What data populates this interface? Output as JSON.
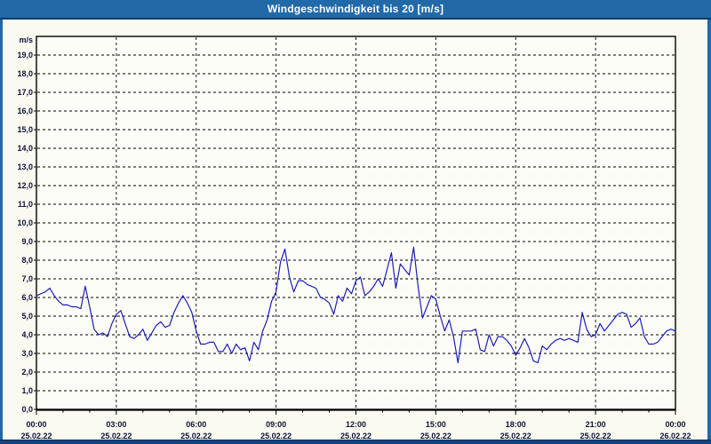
{
  "window": {
    "title": "Windgeschwindigkeit bis 20 [m/s]"
  },
  "colors": {
    "titlebar_bg": "#2169a7",
    "titlebar_edge": "#0c3a66",
    "frame_side": "#2169a7",
    "frame_bottom": "#16437f",
    "body_bg": "#fafaf0",
    "plot_bg": "#fdfdf8",
    "grid": "#000000",
    "axis_text": "#10103a",
    "line": "#1d1db5"
  },
  "chart_data": {
    "type": "line",
    "title": "Windgeschwindigkeit bis 20 [m/s]",
    "ylabel_unit": "m/s",
    "ylim": [
      0,
      20
    ],
    "ytick_step": 1.0,
    "ytick_labels": [
      "0,0",
      "1,0",
      "2,0",
      "3,0",
      "4,0",
      "5,0",
      "6,0",
      "7,0",
      "8,0",
      "9,0",
      "10,0",
      "11,0",
      "12,0",
      "13,0",
      "14,0",
      "15,0",
      "16,0",
      "17,0",
      "18,0",
      "19,0"
    ],
    "x_range_minutes": [
      0,
      1440
    ],
    "x_major_ticks": [
      {
        "time": "00:00",
        "date": "25.02.22"
      },
      {
        "time": "03:00",
        "date": "25.02.22"
      },
      {
        "time": "06:00",
        "date": "25.02.22"
      },
      {
        "time": "09:00",
        "date": "25.02.22"
      },
      {
        "time": "12:00",
        "date": "25.02.22"
      },
      {
        "time": "15:00",
        "date": "25.02.22"
      },
      {
        "time": "18:00",
        "date": "25.02.22"
      },
      {
        "time": "21:00",
        "date": "25.02.22"
      },
      {
        "time": "00:00",
        "date": "26.02.22"
      }
    ],
    "x_minor_tick_every_minutes": 60,
    "grid": "dashed",
    "legend": "none",
    "series": [
      {
        "name": "Windgeschwindigkeit [m/s]",
        "color": "#1d1db5",
        "points_format": "[minutes_from_00:00, m/s]",
        "points": [
          [
            0,
            6.1
          ],
          [
            10,
            6.2
          ],
          [
            20,
            6.3
          ],
          [
            30,
            6.5
          ],
          [
            40,
            6.1
          ],
          [
            50,
            5.8
          ],
          [
            60,
            5.6
          ],
          [
            70,
            5.6
          ],
          [
            80,
            5.5
          ],
          [
            90,
            5.5
          ],
          [
            100,
            5.4
          ],
          [
            110,
            6.6
          ],
          [
            120,
            5.5
          ],
          [
            130,
            4.3
          ],
          [
            140,
            4.0
          ],
          [
            150,
            4.1
          ],
          [
            160,
            3.9
          ],
          [
            170,
            4.6
          ],
          [
            180,
            5.1
          ],
          [
            190,
            5.3
          ],
          [
            200,
            4.6
          ],
          [
            210,
            3.9
          ],
          [
            220,
            3.8
          ],
          [
            230,
            4.0
          ],
          [
            240,
            4.3
          ],
          [
            250,
            3.7
          ],
          [
            260,
            4.1
          ],
          [
            270,
            4.5
          ],
          [
            280,
            4.7
          ],
          [
            290,
            4.4
          ],
          [
            300,
            4.5
          ],
          [
            310,
            5.2
          ],
          [
            320,
            5.7
          ],
          [
            330,
            6.1
          ],
          [
            340,
            5.7
          ],
          [
            350,
            5.2
          ],
          [
            360,
            4.2
          ],
          [
            370,
            3.5
          ],
          [
            380,
            3.5
          ],
          [
            390,
            3.6
          ],
          [
            400,
            3.6
          ],
          [
            410,
            3.1
          ],
          [
            420,
            3.1
          ],
          [
            430,
            3.5
          ],
          [
            440,
            3.0
          ],
          [
            450,
            3.5
          ],
          [
            460,
            3.2
          ],
          [
            470,
            3.3
          ],
          [
            480,
            2.6
          ],
          [
            490,
            3.6
          ],
          [
            500,
            3.2
          ],
          [
            510,
            4.2
          ],
          [
            520,
            4.8
          ],
          [
            530,
            5.8
          ],
          [
            540,
            6.3
          ],
          [
            550,
            7.9
          ],
          [
            560,
            8.6
          ],
          [
            570,
            7.1
          ],
          [
            580,
            6.3
          ],
          [
            590,
            6.9
          ],
          [
            600,
            6.9
          ],
          [
            610,
            6.7
          ],
          [
            620,
            6.6
          ],
          [
            630,
            6.5
          ],
          [
            640,
            6.0
          ],
          [
            650,
            5.9
          ],
          [
            660,
            5.7
          ],
          [
            670,
            5.1
          ],
          [
            680,
            6.1
          ],
          [
            690,
            5.8
          ],
          [
            700,
            6.5
          ],
          [
            710,
            6.2
          ],
          [
            720,
            6.9
          ],
          [
            730,
            7.1
          ],
          [
            740,
            6.1
          ],
          [
            750,
            6.3
          ],
          [
            760,
            6.6
          ],
          [
            770,
            7.0
          ],
          [
            780,
            6.6
          ],
          [
            790,
            7.5
          ],
          [
            800,
            8.4
          ],
          [
            810,
            6.5
          ],
          [
            820,
            7.8
          ],
          [
            830,
            7.5
          ],
          [
            840,
            7.2
          ],
          [
            850,
            8.7
          ],
          [
            860,
            6.6
          ],
          [
            870,
            4.9
          ],
          [
            880,
            5.5
          ],
          [
            890,
            6.1
          ],
          [
            900,
            5.9
          ],
          [
            910,
            5.0
          ],
          [
            920,
            4.2
          ],
          [
            930,
            4.8
          ],
          [
            940,
            3.9
          ],
          [
            950,
            2.5
          ],
          [
            960,
            4.2
          ],
          [
            970,
            4.2
          ],
          [
            980,
            4.2
          ],
          [
            990,
            4.3
          ],
          [
            1000,
            3.2
          ],
          [
            1010,
            3.1
          ],
          [
            1020,
            4.0
          ],
          [
            1030,
            3.4
          ],
          [
            1040,
            3.9
          ],
          [
            1050,
            3.9
          ],
          [
            1060,
            3.7
          ],
          [
            1070,
            3.4
          ],
          [
            1080,
            2.9
          ],
          [
            1090,
            3.3
          ],
          [
            1100,
            3.8
          ],
          [
            1110,
            3.3
          ],
          [
            1120,
            2.6
          ],
          [
            1130,
            2.5
          ],
          [
            1140,
            3.4
          ],
          [
            1150,
            3.2
          ],
          [
            1160,
            3.5
          ],
          [
            1170,
            3.7
          ],
          [
            1180,
            3.8
          ],
          [
            1190,
            3.7
          ],
          [
            1200,
            3.8
          ],
          [
            1210,
            3.7
          ],
          [
            1220,
            3.6
          ],
          [
            1230,
            5.2
          ],
          [
            1240,
            4.3
          ],
          [
            1250,
            3.9
          ],
          [
            1260,
            4.0
          ],
          [
            1270,
            4.6
          ],
          [
            1280,
            4.2
          ],
          [
            1290,
            4.5
          ],
          [
            1300,
            4.8
          ],
          [
            1310,
            5.1
          ],
          [
            1320,
            5.2
          ],
          [
            1330,
            5.1
          ],
          [
            1340,
            4.4
          ],
          [
            1350,
            4.6
          ],
          [
            1360,
            4.9
          ],
          [
            1370,
            3.9
          ],
          [
            1380,
            3.5
          ],
          [
            1390,
            3.5
          ],
          [
            1400,
            3.6
          ],
          [
            1410,
            3.9
          ],
          [
            1420,
            4.2
          ],
          [
            1430,
            4.3
          ],
          [
            1440,
            4.2
          ]
        ]
      }
    ]
  }
}
